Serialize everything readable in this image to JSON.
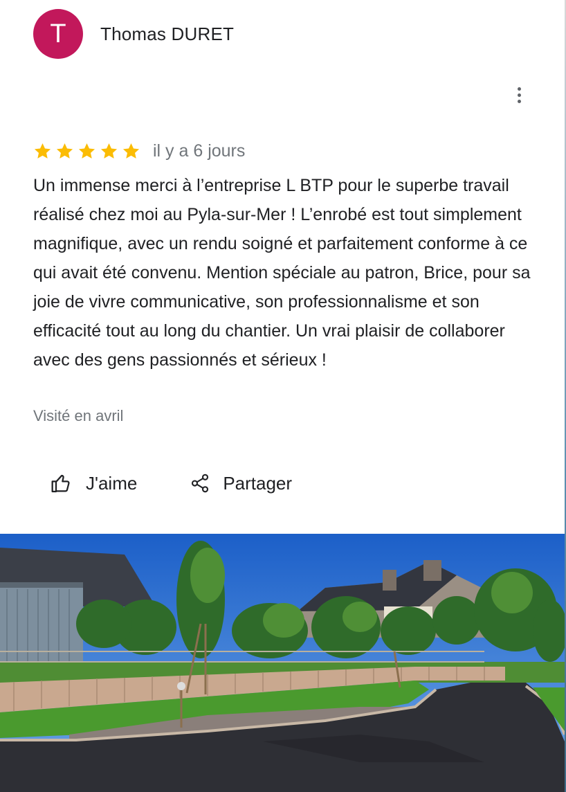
{
  "review": {
    "author": {
      "initial": "T",
      "name": "Thomas DURET",
      "avatar_color": "#c2185b"
    },
    "rating": 5,
    "rating_max": 5,
    "star_color": "#fbbc04",
    "time_ago": "il y a 6 jours",
    "text": "Un immense merci à l’entreprise L BTP pour le superbe travail réalisé chez moi au Pyla-sur-Mer ! L’enrobé est tout simplement magnifique, avec un rendu soigné et parfaitement conforme à ce qui avait été convenu. Mention spéciale au patron, Brice, pour sa joie de vivre communicative, son professionnalisme et son efficacité tout au long du chantier. Un vrai plaisir de collaborer avec des gens passionnés et sérieux !",
    "visited": "Visité en avril"
  },
  "actions": {
    "like_label": "J'aime",
    "share_label": "Partager"
  },
  "icons": {
    "more": "more-vert-icon",
    "like": "thumb-up-icon",
    "share": "share-icon",
    "star": "star-icon"
  }
}
